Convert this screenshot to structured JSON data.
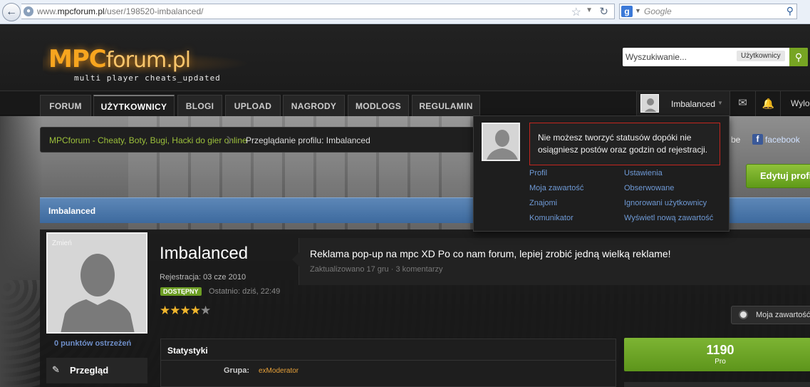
{
  "browser": {
    "url_prefix": "www.",
    "url_domain": "mpcforum.pl",
    "url_path": "/user/198520-imbalanced/",
    "search_engine_letter": "g",
    "search_placeholder": "Google"
  },
  "header": {
    "logo_main": "MPC",
    "logo_suffix": "forum.pl",
    "logo_tagline": "multi player cheats_updated",
    "search_placeholder": "Wyszukiwanie...",
    "search_scope": "Użytkownicy"
  },
  "nav": {
    "tabs": [
      {
        "label": "FORUM"
      },
      {
        "label": "UŻYTKOWNICY"
      },
      {
        "label": "BLOGI"
      },
      {
        "label": "UPLOAD"
      },
      {
        "label": "NAGRODY"
      },
      {
        "label": "MODLOGS"
      },
      {
        "label": "REGULAMIN"
      }
    ],
    "active_tab": "UŻYTKOWNICY",
    "user_name": "Imbalanced",
    "logout_label": "Wylog"
  },
  "breadcrumb": {
    "home": "MPCforum - Cheaty, Boty, Bugi, Hacki do gier online",
    "current": "Przeglądanie profilu: Imbalanced"
  },
  "share": {
    "fragment": "be",
    "facebook_label": "facebook"
  },
  "edit_button_label": "Edytuj profi",
  "profile_bar_title": "Imbalanced",
  "profile": {
    "avatar_change": "Zmień",
    "points": "0 punktów ostrzeżeń",
    "sidenav_label": "Przegląd",
    "username": "Imbalanced",
    "registration": "Rejestracja: 03 cze 2010",
    "online_badge": "DOSTĘPNY",
    "last_seen": "Ostatnio: dziś, 22:49",
    "rating": 4,
    "rating_max": 5,
    "status_text": "Reklama pop-up na mpc XD Po co nam forum, lepiej zrobić jedną wielką reklame!",
    "status_meta": "Zaktualizowano 17 gru · 3 komentarzy",
    "content_button": "Moja zawartość",
    "stats_title": "Statystyki",
    "group_key": "Grupa:",
    "group_value": "exModerator",
    "rep_value": "1190",
    "rep_label": "Pro"
  },
  "dropdown": {
    "warning": "Nie możesz tworzyć statusów dopóki nie osiągniesz postów oraz godzin od rejestracji.",
    "links_left": [
      "Profil",
      "Moja zawartość",
      "Znajomi",
      "Komunikator"
    ],
    "links_right": [
      "Ustawienia",
      "Obserwowane",
      "Ignorowani użytkownicy",
      "Wyświetl nową zawartość"
    ]
  },
  "colors": {
    "accent_green": "#77a523",
    "link_green": "#9cc03b",
    "profile_blue": "#4a77aa",
    "warning_red": "#c4261f"
  }
}
